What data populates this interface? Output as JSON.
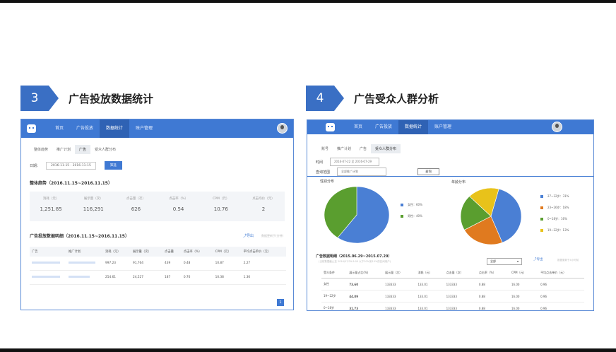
{
  "sections": [
    {
      "number": "3",
      "title": "广告投放数据统计"
    },
    {
      "number": "4",
      "title": "广告受众人群分析"
    }
  ],
  "colors": {
    "accent": "#3a6fc4",
    "nav": "#3f79d3",
    "green": "#5a9e2f",
    "blue": "#4a7fd4",
    "orange": "#e07a1f",
    "yellow": "#e8c21a"
  },
  "shotA": {
    "nav": [
      "首页",
      "广告投放",
      "数据统计",
      "账户管理"
    ],
    "tabs": [
      "整体趋势",
      "推广计划",
      "广告",
      "受众人群分布"
    ],
    "date_label": "日期：",
    "date_value": "2016-11-15 - 2016-11-15",
    "query_button": "筛选",
    "overall_title": "整体趋势（2016.11.15~2016.11.15）",
    "kpis": [
      {
        "label": "消耗（元）",
        "value": "1,251.85"
      },
      {
        "label": "展示量（次）",
        "value": "116,291"
      },
      {
        "label": "点击量（次）",
        "value": "626"
      },
      {
        "label": "点击率（%）",
        "value": "0.54"
      },
      {
        "label": "CPM（元）",
        "value": "10.76"
      },
      {
        "label": "点击均价（元）",
        "value": "2"
      }
    ],
    "detail_title": "广告投放数据明细（2016.11.15~2016.11.15）",
    "export": "导出",
    "export_note": "数据更新于(分钟)",
    "columns": [
      "广告",
      "推广计划",
      "消耗（元）",
      "展示量（次）",
      "点击量",
      "点击率（%）",
      "CPM（元）",
      "平均点击单价（元）"
    ],
    "rows": [
      [
        "",
        "",
        "997.23",
        "91,764",
        "439",
        "0.48",
        "10.87",
        "2.27"
      ],
      [
        "",
        "",
        "254.61",
        "24,527",
        "187",
        "0.76",
        "10.38",
        "1.36"
      ]
    ],
    "page": "1"
  },
  "shotB": {
    "nav": [
      "首页",
      "广告投放",
      "数据统计",
      "账户管理"
    ],
    "tabs": [
      "账号",
      "推广计划",
      "广告",
      "受众人群分布"
    ],
    "time_label": "时间",
    "time_value": "2016-07-22 至 2016-07-29",
    "range_label": "查询范围",
    "range_value": "全部推广计划",
    "query_button": "查询",
    "gender_title": "性别分布",
    "age_title": "年龄分布",
    "gender_legend": [
      {
        "label": "女性：60%",
        "color": "#4a7fd4",
        "value": 60
      },
      {
        "label": "男性：40%",
        "color": "#5a9e2f",
        "value": 40
      }
    ],
    "age_legend": [
      {
        "label": "27~32岁：31%",
        "color": "#4a7fd4",
        "value": 31
      },
      {
        "label": "23~26岁：18%",
        "color": "#e07a1f",
        "value": 18
      },
      {
        "label": "0~18岁：16%",
        "color": "#5a9e2f",
        "value": 16
      },
      {
        "label": "19~22岁：13%",
        "color": "#e8c21a",
        "value": 13
      }
    ],
    "detail_title": "广告数据明细（2015.06.29~2015.07.29）",
    "detail_note": "(当前数据截止至  2016/07/29 8:00 以下30%到10%的区间用户)",
    "select_value": "全部",
    "export": "导出",
    "export_note": "数据更新于4小时前",
    "columns": [
      "受众条件",
      "展示量占比(%)",
      "展示量（次）",
      "消耗（元）",
      "点击量（次）",
      "点击率（%）",
      "CPM（元）",
      "平均点击单价（元）"
    ],
    "rows": [
      [
        "女性",
        "73.60",
        "133333",
        "133.01",
        "133333",
        "0.88",
        "16.00",
        "0.96"
      ],
      [
        "19~22岁",
        "44.89",
        "133333",
        "133.01",
        "133333",
        "0.88",
        "16.00",
        "0.96"
      ],
      [
        "0~18岁",
        "31.73",
        "133333",
        "133.01",
        "133333",
        "0.88",
        "16.00",
        "0.96"
      ]
    ]
  }
}
